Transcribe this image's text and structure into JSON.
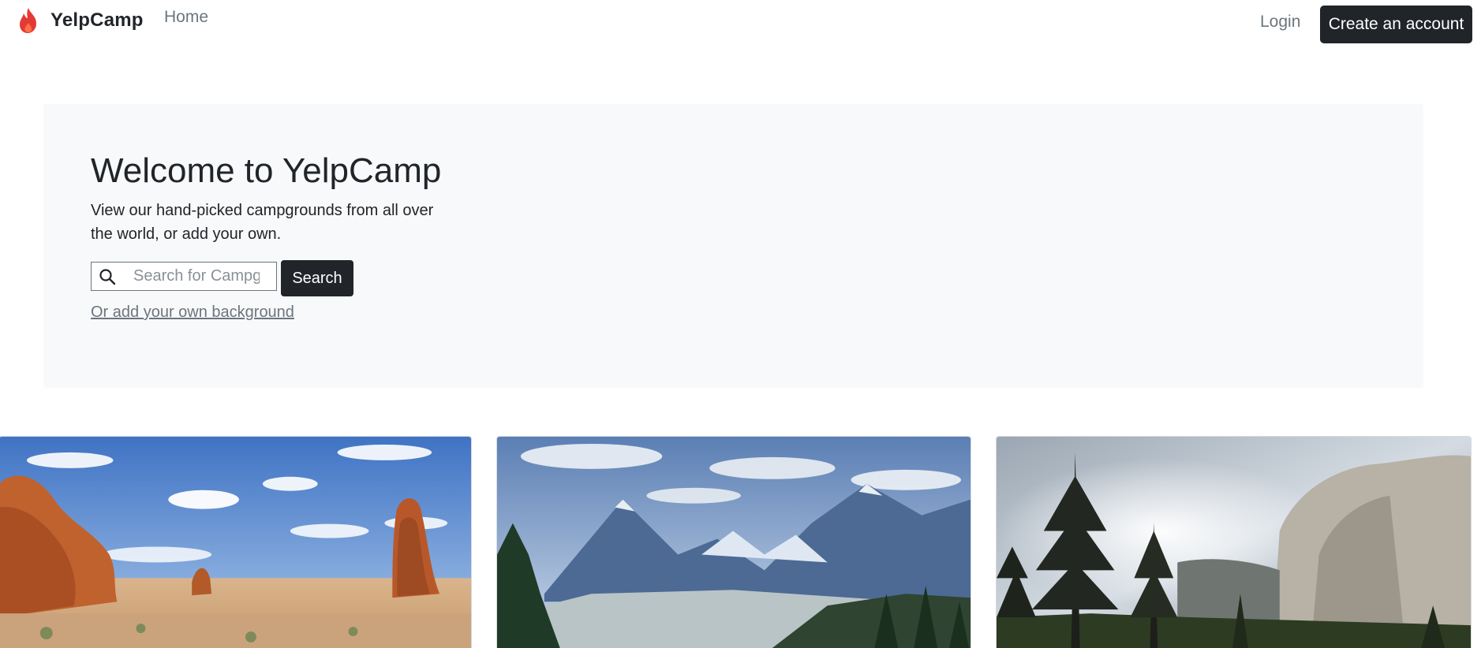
{
  "navbar": {
    "brand": "YelpCamp",
    "brand_icon": "flame-icon",
    "brand_color": "#e53935",
    "home": "Home",
    "login": "Login",
    "create_account": "Create an account"
  },
  "hero": {
    "title": "Welcome to YelpCamp",
    "lead": "View our hand-picked campgrounds from all over the world, or add your own.",
    "search_placeholder": "Search for Campgrounds",
    "search_icon": "search-icon",
    "search_button": "Search",
    "background_link": "Or add your own background"
  },
  "cards": [
    {
      "image": "desert-rock-formations-photo"
    },
    {
      "image": "mountain-valley-photo"
    },
    {
      "image": "granite-cliff-forest-photo"
    }
  ],
  "colors": {
    "dark": "#212529",
    "muted": "#6c757d",
    "hero_bg": "#f8f9fa"
  }
}
